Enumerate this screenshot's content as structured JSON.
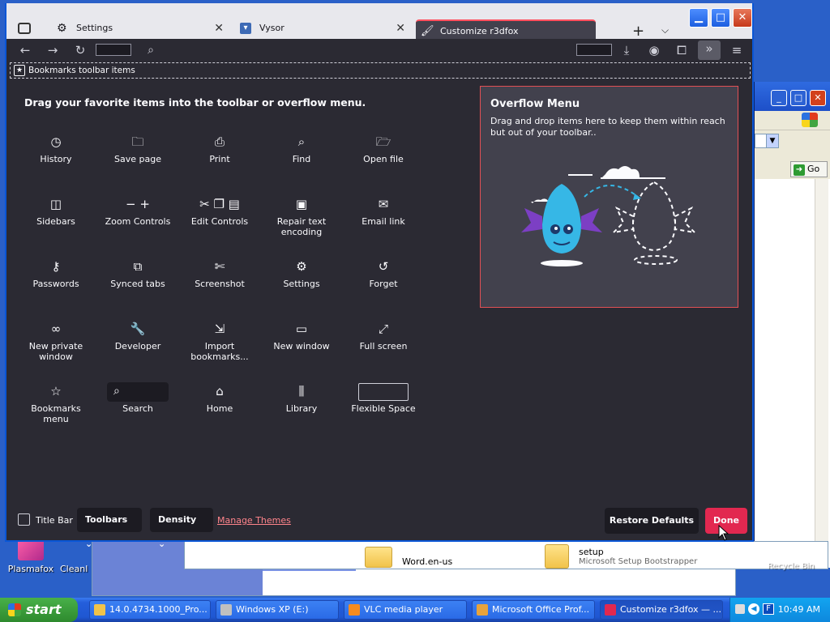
{
  "desktop": {
    "icons": [
      {
        "label": "Plasmafox"
      },
      {
        "label": "Cleanl"
      },
      {
        "label": "Recycle Bin"
      }
    ]
  },
  "background_window": {
    "go_label": "Go"
  },
  "file_pane": {
    "items": [
      {
        "name": "Word.en-us",
        "sub": ""
      },
      {
        "name": "setup",
        "sub": "Microsoft Setup Bootstrapper"
      }
    ]
  },
  "browser": {
    "tabs": [
      {
        "label": "Settings",
        "icon": "gear-icon"
      },
      {
        "label": "Vysor",
        "icon": "vysor-icon"
      },
      {
        "label": "Customize r3dfox",
        "icon": "customize-icon",
        "active": true
      }
    ],
    "bookmarks_toolbar_label": "Bookmarks toolbar items",
    "customize": {
      "heading": "Drag your favorite items into the toolbar or overflow menu.",
      "items": [
        {
          "label": "History",
          "icon": "history-icon",
          "glyph": "◷"
        },
        {
          "label": "Save page",
          "icon": "save-page-icon",
          "glyph": "🗀"
        },
        {
          "label": "Print",
          "icon": "print-icon",
          "glyph": "⎙"
        },
        {
          "label": "Find",
          "icon": "find-icon",
          "glyph": "⌕"
        },
        {
          "label": "Open file",
          "icon": "open-file-icon",
          "glyph": "🗁"
        },
        {
          "label": "Sidebars",
          "icon": "sidebars-icon",
          "glyph": "◫"
        },
        {
          "label": "Zoom Controls",
          "icon": "zoom-controls-icon",
          "glyph": "− +"
        },
        {
          "label": "Edit Controls",
          "icon": "edit-controls-icon",
          "glyph": "✂ ❐ ▤"
        },
        {
          "label": "Repair text encoding",
          "icon": "repair-encoding-icon",
          "glyph": "▣"
        },
        {
          "label": "Email link",
          "icon": "email-link-icon",
          "glyph": "✉"
        },
        {
          "label": "Passwords",
          "icon": "passwords-icon",
          "glyph": "⚷"
        },
        {
          "label": "Synced tabs",
          "icon": "synced-tabs-icon",
          "glyph": "⧉"
        },
        {
          "label": "Screenshot",
          "icon": "screenshot-icon",
          "glyph": "✄"
        },
        {
          "label": "Settings",
          "icon": "settings-icon",
          "glyph": "⚙"
        },
        {
          "label": "Forget",
          "icon": "forget-icon",
          "glyph": "↺"
        },
        {
          "label": "New private window",
          "icon": "private-window-icon",
          "glyph": "∞"
        },
        {
          "label": "Developer",
          "icon": "developer-icon",
          "glyph": "🔧"
        },
        {
          "label": "Import bookmarks...",
          "icon": "import-bookmarks-icon",
          "glyph": "⇲"
        },
        {
          "label": "New window",
          "icon": "new-window-icon",
          "glyph": "▭"
        },
        {
          "label": "Full screen",
          "icon": "full-screen-icon",
          "glyph": "⤢"
        },
        {
          "label": "Bookmarks menu",
          "icon": "bookmarks-menu-icon",
          "glyph": "☆"
        },
        {
          "label": "Search",
          "icon": "search-icon",
          "glyph": "⌕"
        },
        {
          "label": "Home",
          "icon": "home-icon",
          "glyph": "⌂"
        },
        {
          "label": "Library",
          "icon": "library-icon",
          "glyph": "⫼"
        },
        {
          "label": "Flexible Space",
          "icon": "flexible-space-icon",
          "glyph": ""
        }
      ]
    },
    "overflow": {
      "title": "Overflow Menu",
      "description": "Drag and drop items here to keep them within reach but out of your toolbar.."
    },
    "footer": {
      "title_bar_label": "Title Bar",
      "toolbars_label": "Toolbars",
      "density_label": "Density",
      "manage_themes_label": "Manage Themes",
      "restore_defaults_label": "Restore Defaults",
      "done_label": "Done"
    }
  },
  "taskbar": {
    "start_label": "start",
    "tasks": [
      {
        "label": "14.0.4734.1000_Pro...",
        "icon": "folder-icon"
      },
      {
        "label": "Windows XP (E:)",
        "icon": "drive-icon"
      },
      {
        "label": "VLC media player",
        "icon": "vlc-icon"
      },
      {
        "label": "Microsoft Office Prof...",
        "icon": "office-icon"
      },
      {
        "label": "Customize r3dfox — ...",
        "icon": "r3dfox-icon",
        "active": true
      }
    ],
    "clock": "10:49 AM"
  },
  "colors": {
    "accent": "#e22850",
    "panel_border": "#e25055",
    "dark_bg": "#2b2a33",
    "taskbar": "#245edb"
  }
}
